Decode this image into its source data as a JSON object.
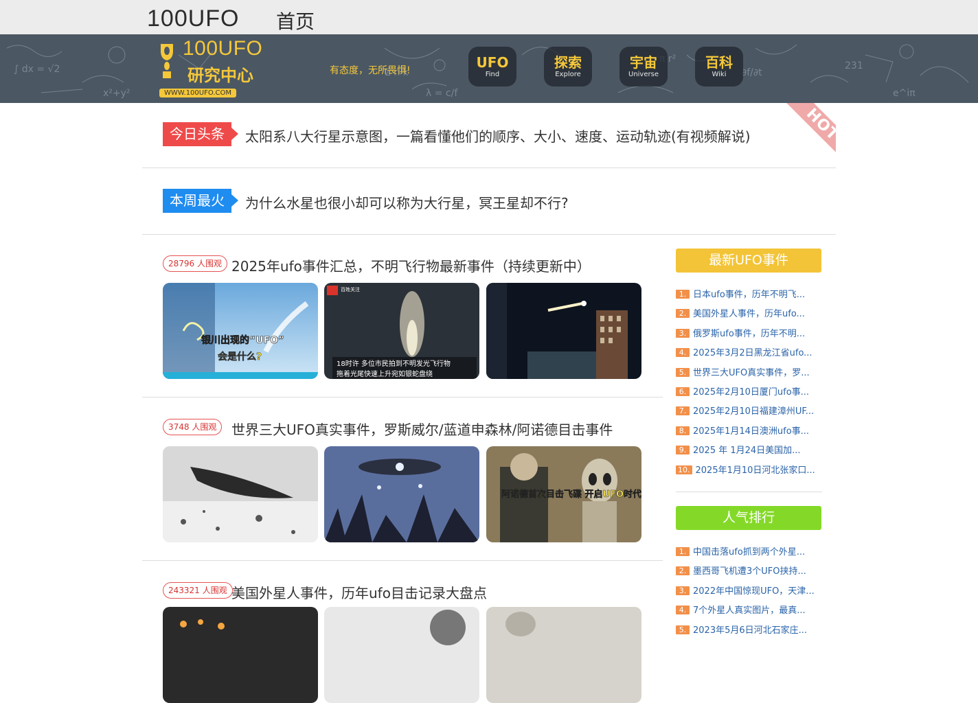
{
  "topbar": {
    "brand": "100UFO",
    "home": "首页"
  },
  "banner": {
    "logo_main": "100UFO",
    "logo_sub": "研究中心",
    "logo_url": "WWW.100UFO.COM",
    "slogan": "有态度，无所畏惧!",
    "nav": [
      {
        "cn": "UFO",
        "en": "Find"
      },
      {
        "cn": "探索",
        "en": "Explore"
      },
      {
        "cn": "宇宙",
        "en": "Universe"
      },
      {
        "cn": "百科",
        "en": "Wiki"
      }
    ]
  },
  "headlines": [
    {
      "tag": "今日头条",
      "text": "太阳系八大行星示意图，一篇看懂他们的顺序、大小、速度、运动轨迹(有视频解说)"
    },
    {
      "tag": "本周最火",
      "text": "为什么水星也很小却可以称为大行星，冥王星却不行?"
    }
  ],
  "hot_label": "HOT",
  "articles": [
    {
      "views": "28796 人围观",
      "title": "2025年ufo事件汇总，不明飞行物最新事件（持续更新中）",
      "thumb_text": [
        "银川出现的“UFO”",
        "会是什么?",
        "18时许 多位市民拍到不明发光飞行物",
        "拖着光尾快速上升宛如银蛇盘绕",
        "百姓关注"
      ]
    },
    {
      "views": "3748 人围观",
      "title": "世界三大UFO真实事件，罗斯威尔/蓝道申森林/阿诺德目击事件",
      "thumb_text": [
        "阿诺德首次目击飞碟 开启UFO时代"
      ]
    },
    {
      "views": "243321 人围观",
      "title": "美国外星人事件，历年ufo目击记录大盘点",
      "thumb_text": []
    }
  ],
  "sidebar": {
    "latest_title": "最新UFO事件",
    "latest": [
      {
        "num": "1.",
        "text": "日本ufo事件，历年不明飞..."
      },
      {
        "num": "2.",
        "text": "美国外星人事件，历年ufo..."
      },
      {
        "num": "3.",
        "text": "俄罗斯ufo事件，历年不明..."
      },
      {
        "num": "4.",
        "text": "2025年3月2日黑龙江省ufo..."
      },
      {
        "num": "5.",
        "text": "世界三大UFO真实事件，罗..."
      },
      {
        "num": "6.",
        "text": "2025年2月10日厦门ufo事..."
      },
      {
        "num": "7.",
        "text": "2025年2月10日福建漳州UF..."
      },
      {
        "num": "8.",
        "text": "2025年1月14日澳洲ufo事..."
      },
      {
        "num": "9.",
        "text": "2025 年 1月24日美国加..."
      },
      {
        "num": "10.",
        "text": "2025年1月10日河北张家口..."
      }
    ],
    "popular_title": "人气排行",
    "popular": [
      {
        "num": "1.",
        "text": "中国击落ufo抓到两个外星..."
      },
      {
        "num": "2.",
        "text": "墨西哥飞机遭3个UFO挟持..."
      },
      {
        "num": "3.",
        "text": "2022年中国惊现UFO，天津..."
      },
      {
        "num": "4.",
        "text": "7个外星人真实图片，最真..."
      },
      {
        "num": "5.",
        "text": "2023年5月6日河北石家庄..."
      }
    ]
  }
}
